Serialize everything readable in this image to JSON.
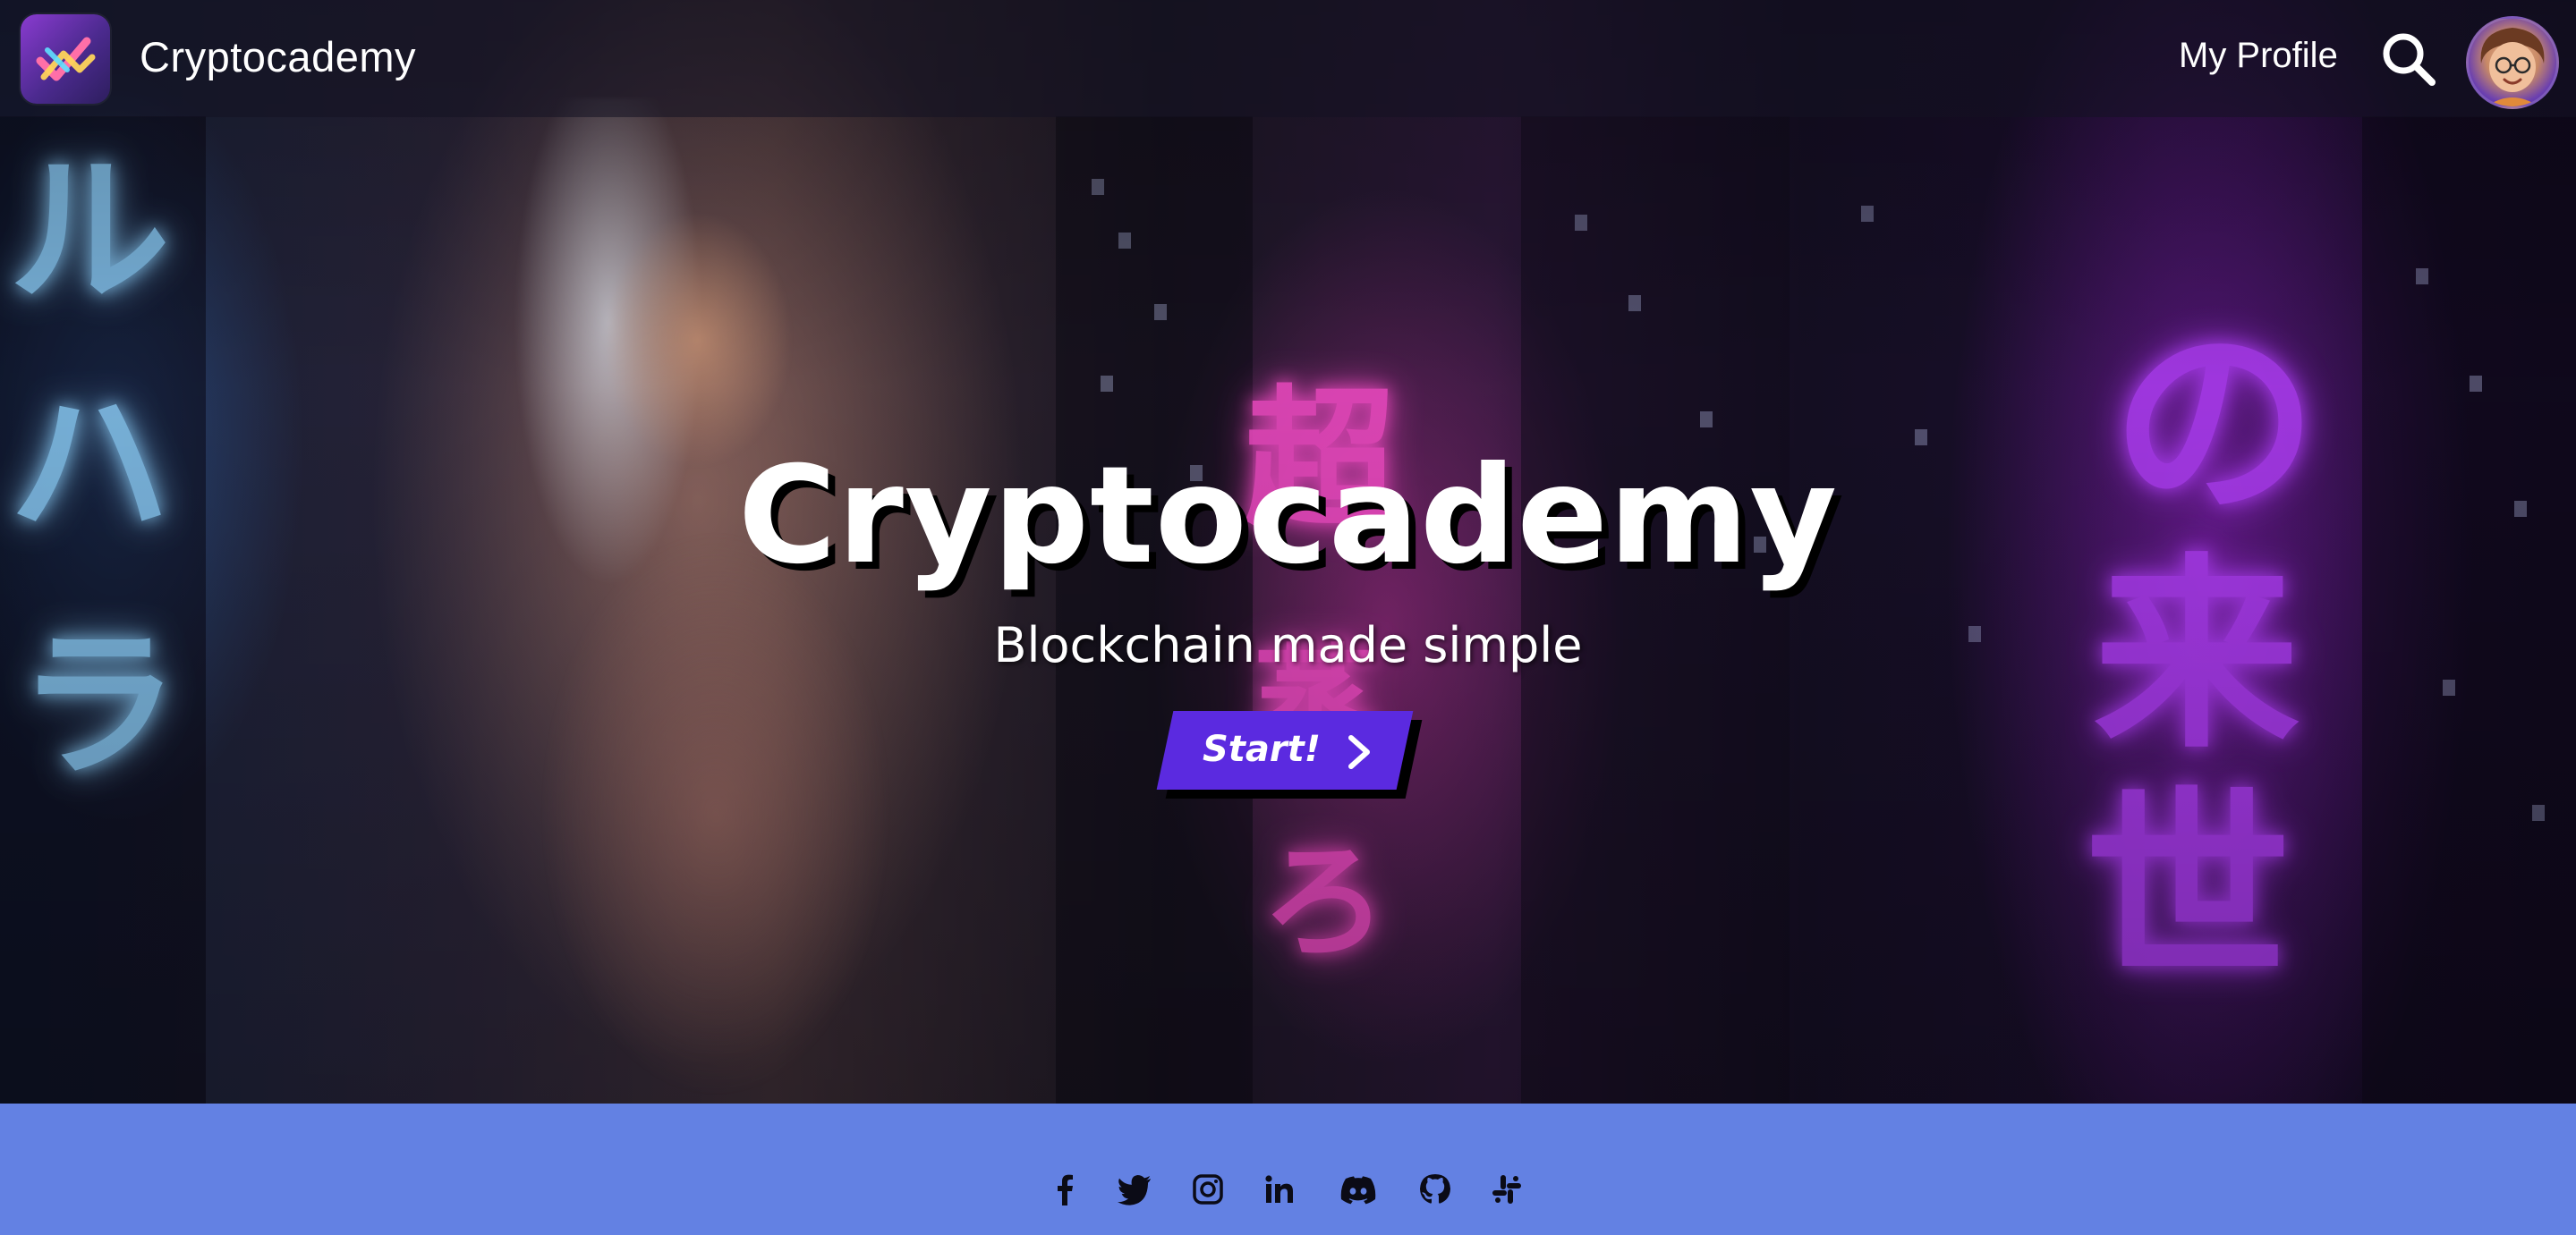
{
  "header": {
    "brand": "Cryptocademy",
    "profile_link": "My Profile",
    "search_icon": "search-icon",
    "avatar_icon": "user-avatar"
  },
  "hero": {
    "title": "Cryptocademy",
    "subtitle": "Blockchain made simple",
    "start_label": "Start!",
    "start_icon": "chevron-right-icon",
    "neon_signs": [
      "ル",
      "ハ",
      "ラ",
      "超",
      "蒸",
      "ろ",
      "の",
      "来",
      "世"
    ],
    "colors": {
      "button": "#5b2ae0",
      "footer": "#6381e3",
      "neon_pink": "#ff4fcf",
      "neon_purple": "#b640ff",
      "neon_blue": "#8fd3ff"
    }
  },
  "footer": {
    "social": [
      {
        "name": "facebook-icon"
      },
      {
        "name": "twitter-icon"
      },
      {
        "name": "instagram-icon"
      },
      {
        "name": "linkedin-icon"
      },
      {
        "name": "discord-icon"
      },
      {
        "name": "github-icon"
      },
      {
        "name": "slack-icon"
      }
    ]
  }
}
